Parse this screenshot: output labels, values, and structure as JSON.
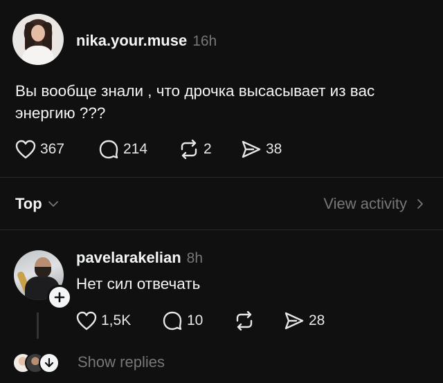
{
  "post": {
    "username": "nika.your.muse",
    "time": "16h",
    "text": "Вы вообще знали , что дрочка высасывает из вас энергию ???",
    "stats": {
      "likes": "367",
      "comments": "214",
      "reposts": "2",
      "shares": "38"
    }
  },
  "filter": {
    "sort_label": "Top",
    "view_activity_label": "View activity"
  },
  "reply": {
    "username": "pavelarakelian",
    "time": "8h",
    "text": "Нет сил отвечать",
    "stats": {
      "likes": "1,5K",
      "comments": "10",
      "reposts": "",
      "shares": "28"
    },
    "show_replies_label": "Show replies"
  },
  "icons": [
    "heart-icon",
    "comment-icon",
    "repost-icon",
    "share-icon",
    "chevron-down-icon",
    "chevron-right-icon",
    "plus-icon",
    "arrow-down-icon"
  ]
}
